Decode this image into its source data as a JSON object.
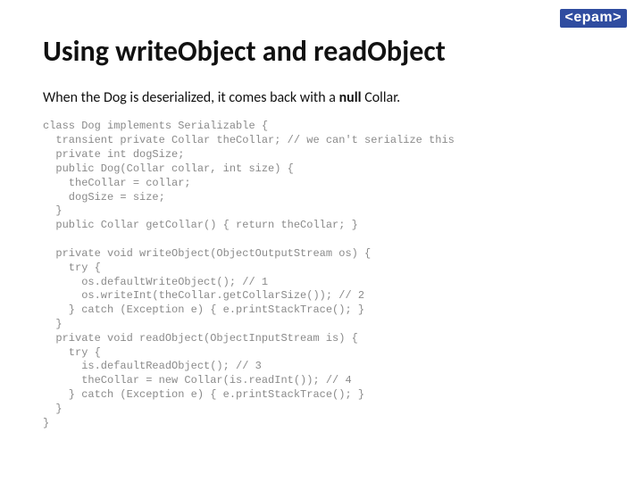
{
  "logo": "<epam>",
  "title": "Using writeObject and readObject",
  "subtitle_pre": "When the Dog is deserialized, it comes back with a ",
  "subtitle_bold": "null",
  "subtitle_post": " Collar.",
  "code": "class Dog implements Serializable {\n  transient private Collar theCollar; // we can't serialize this\n  private int dogSize;\n  public Dog(Collar collar, int size) {\n    theCollar = collar;\n    dogSize = size;\n  }\n  public Collar getCollar() { return theCollar; }\n\n  private void writeObject(ObjectOutputStream os) {\n    try {\n      os.defaultWriteObject(); // 1\n      os.writeInt(theCollar.getCollarSize()); // 2\n    } catch (Exception e) { e.printStackTrace(); }\n  }\n  private void readObject(ObjectInputStream is) {\n    try {\n      is.defaultReadObject(); // 3\n      theCollar = new Collar(is.readInt()); // 4\n    } catch (Exception e) { e.printStackTrace(); }\n  }\n}"
}
